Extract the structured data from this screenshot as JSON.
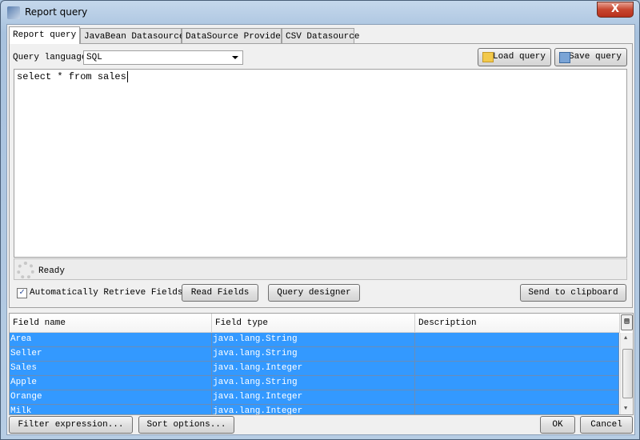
{
  "window": {
    "title": "Report query",
    "close_glyph": "X"
  },
  "tabs": [
    {
      "label": "Report query",
      "active": true
    },
    {
      "label": "JavaBean Datasource"
    },
    {
      "label": "DataSource Provider"
    },
    {
      "label": "CSV Datasource"
    }
  ],
  "query": {
    "language_label": "Query language",
    "language_value": "SQL",
    "load_label": "Load query",
    "save_label": "Save query",
    "text": "select * from sales"
  },
  "status": {
    "text": "Ready"
  },
  "actions": {
    "auto_retrieve_label": "Automatically Retrieve Fields",
    "auto_retrieve_checked": true,
    "read_fields": "Read Fields",
    "query_designer": "Query designer",
    "send_clipboard": "Send to clipboard"
  },
  "table": {
    "columns": [
      "Field name",
      "Field type",
      "Description"
    ],
    "rows": [
      [
        "Area",
        "java.lang.String",
        ""
      ],
      [
        "Seller",
        "java.lang.String",
        ""
      ],
      [
        "Sales",
        "java.lang.Integer",
        ""
      ],
      [
        "Apple",
        "java.lang.String",
        ""
      ],
      [
        "Orange",
        "java.lang.Integer",
        ""
      ],
      [
        "Milk",
        "java.lang.Integer",
        ""
      ]
    ],
    "selection_color": "#3399ff"
  },
  "footer": {
    "filter": "Filter expression...",
    "sort": "Sort options...",
    "ok": "OK",
    "cancel": "Cancel"
  }
}
